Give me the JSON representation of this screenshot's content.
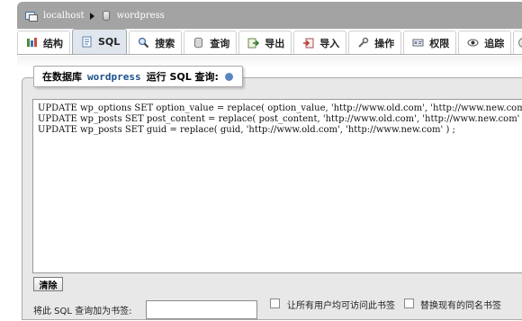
{
  "breadcrumb": {
    "server": "localhost",
    "database": "wordpress"
  },
  "tabs": [
    {
      "label": "结构",
      "icon": "structure-icon"
    },
    {
      "label": "SQL",
      "icon": "sql-icon"
    },
    {
      "label": "搜索",
      "icon": "search-icon"
    },
    {
      "label": "查询",
      "icon": "query-icon"
    },
    {
      "label": "导出",
      "icon": "export-icon"
    },
    {
      "label": "导入",
      "icon": "import-icon"
    },
    {
      "label": "操作",
      "icon": "operations-icon"
    },
    {
      "label": "权限",
      "icon": "privileges-icon"
    },
    {
      "label": "追踪",
      "icon": "tracking-icon"
    }
  ],
  "active_tab": "SQL",
  "query_panel": {
    "legend_prefix": "在数据库",
    "legend_db": "wordpress",
    "legend_suffix": "运行 SQL 查询:",
    "sql_lines": [
      "UPDATE wp_options SET option_value = replace( option_value, 'http://www.old.com', 'http://www.new.com' ) WHERE option_name = 'home' OR option_name = 'siteurl';",
      "UPDATE wp_posts SET post_content = replace( post_content, 'http://www.old.com', 'http://www.new.com' ) ;",
      "UPDATE wp_posts SET guid = replace( guid, 'http://www.old.com', 'http://www.new.com' ) ;"
    ],
    "clear_button": "清除"
  },
  "bookmark": {
    "label": "将此 SQL 查询加为书签:",
    "input_value": "",
    "share_label": "让所有用户均可访问此书签",
    "share_checked": false,
    "replace_label": "替换现有的同名书签",
    "replace_checked": false
  },
  "colors": {
    "topbar": "#a3a3a3",
    "active_tab": "#dfe6ee",
    "panel_bg": "#e8e8e8",
    "db_name": "#1b4f8a"
  }
}
